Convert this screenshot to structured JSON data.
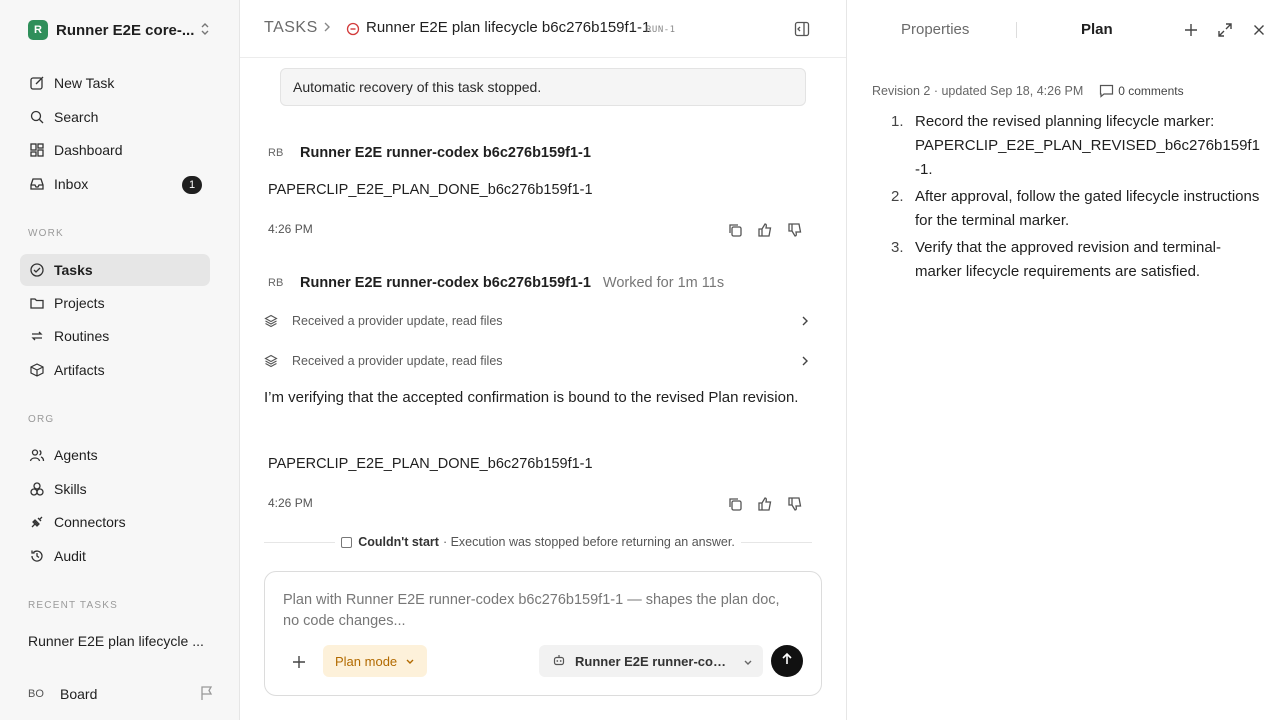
{
  "workspace": {
    "logo_letter": "R",
    "name": "Runner E2E core-..."
  },
  "nav": {
    "new_task": "New Task",
    "search": "Search",
    "dashboard": "Dashboard",
    "inbox": "Inbox",
    "inbox_count": "1"
  },
  "sections": {
    "work": "WORK",
    "org": "ORG",
    "recent": "RECENT TASKS"
  },
  "work_items": {
    "tasks": "Tasks",
    "projects": "Projects",
    "routines": "Routines",
    "artifacts": "Artifacts"
  },
  "org_items": {
    "agents": "Agents",
    "skills": "Skills",
    "connectors": "Connectors",
    "audit": "Audit"
  },
  "recent_task": "Runner E2E plan lifecycle ...",
  "board": {
    "initials": "BO",
    "label": "Board"
  },
  "header": {
    "root": "TASKS",
    "title": "Runner E2E plan lifecycle b6c276b159f1-1",
    "task_id": "RUN-1"
  },
  "thread": {
    "banner": "Automatic recovery of this task stopped.",
    "msg1": {
      "avatar": "RB",
      "author": "Runner E2E runner-codex b6c276b159f1-1",
      "marker": "PAPERCLIP_E2E_PLAN_DONE_b6c276b159f1-1",
      "time": "4:26 PM"
    },
    "msg2": {
      "avatar": "RB",
      "author": "Runner E2E runner-codex b6c276b159f1-1",
      "worked": "Worked for 1m 11s",
      "tool1": "Received a provider update, read files",
      "tool2": "Received a provider update, read files",
      "text": "I’m verifying that the accepted confirmation is bound to the revised Plan revision.",
      "marker": "PAPERCLIP_E2E_PLAN_DONE_b6c276b159f1-1",
      "time": "4:26 PM"
    },
    "status": {
      "label": "Couldn't start",
      "detail": "· Execution was stopped before returning an answer."
    }
  },
  "composer": {
    "placeholder": "Plan with Runner E2E runner-codex b6c276b159f1-1 — shapes the plan doc, no code changes...",
    "mode": "Plan mode",
    "agent": "Runner E2E runner-codex b6c276b159f1-1"
  },
  "right_panel": {
    "tab_properties": "Properties",
    "tab_plan": "Plan",
    "revision": "Revision 2 · updated Sep 18, 4:26 PM",
    "comments": "0 comments",
    "steps": [
      {
        "n": "1.",
        "text": "Record the revised planning lifecycle marker: PAPERCLIP_E2E_PLAN_REVISED_b6c276b159f1-1."
      },
      {
        "n": "2.",
        "text": "After approval, follow the gated lifecycle instructions for the terminal marker."
      },
      {
        "n": "3.",
        "text": "Verify that the approved revision and terminal-marker lifecycle requirements are satisfied."
      }
    ]
  },
  "colors": {
    "accent_orange": "#b26a00",
    "plan_mode_bg": "#fdf1da",
    "status_red": "#d23a3a",
    "logo_green": "#2f8f5a"
  }
}
